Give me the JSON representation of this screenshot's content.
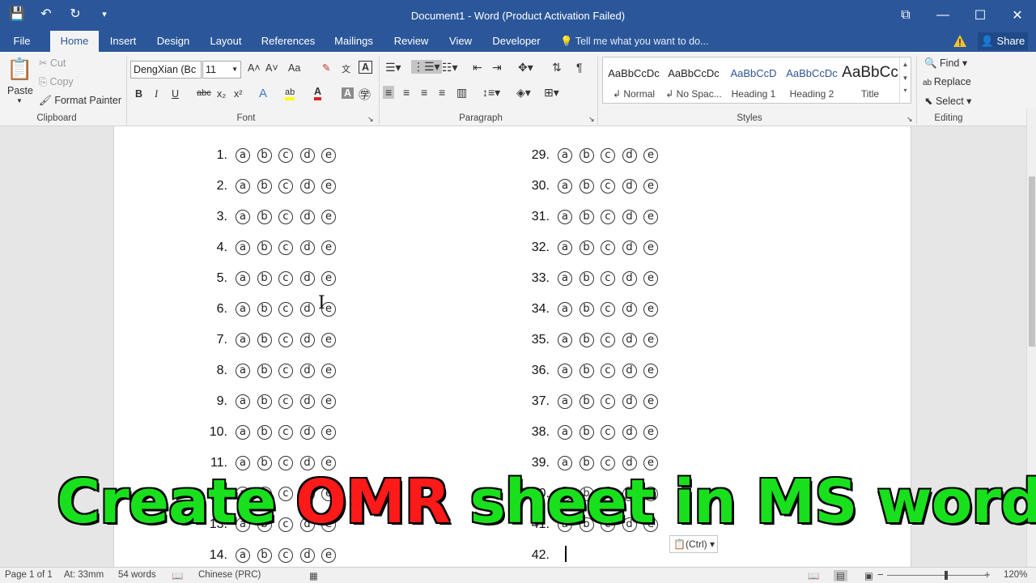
{
  "window": {
    "title": "Document1 - Word (Product Activation Failed)",
    "minimize": "—",
    "maximize": "☐",
    "close": "✕",
    "ribbon_display": "⧉"
  },
  "qat": {
    "save_icon": "💾",
    "undo_icon": "↶",
    "redo_icon": "↻",
    "customize_icon": "▾"
  },
  "tabs": [
    {
      "label": "File"
    },
    {
      "label": "Home"
    },
    {
      "label": "Insert"
    },
    {
      "label": "Design"
    },
    {
      "label": "Layout"
    },
    {
      "label": "References"
    },
    {
      "label": "Mailings"
    },
    {
      "label": "Review"
    },
    {
      "label": "View"
    },
    {
      "label": "Developer"
    }
  ],
  "tellme": "Tell me what you want to do...",
  "share": "Share",
  "clipboard": {
    "paste": "Paste",
    "cut": "Cut",
    "copy": "Copy",
    "format_painter": "Format Painter",
    "group": "Clipboard"
  },
  "font": {
    "name": "DengXian (Bc",
    "size": "11",
    "group": "Font",
    "bold": "B",
    "italic": "I",
    "underline": "U",
    "strike": "abc",
    "sub": "x₂",
    "sup": "x²",
    "grow": "A˄",
    "shrink": "A˅",
    "case": "Aa",
    "texteffects": "A",
    "highlight": "ab",
    "color": "A",
    "shade": "A"
  },
  "paragraph": {
    "group": "Paragraph"
  },
  "styles": {
    "group": "Styles",
    "items": [
      {
        "preview": "AaBbCcDc",
        "name": "↲ Normal"
      },
      {
        "preview": "AaBbCcDc",
        "name": "↲ No Spac..."
      },
      {
        "preview": "AaBbCcD",
        "name": "Heading 1"
      },
      {
        "preview": "AaBbCcDc",
        "name": "Heading 2"
      },
      {
        "preview": "AaBbCc",
        "name": "Title"
      }
    ]
  },
  "editing": {
    "group": "Editing",
    "find": "Find",
    "replace": "Replace",
    "select": "Select"
  },
  "document": {
    "left_questions": [
      "1.",
      "2.",
      "3.",
      "4.",
      "5.",
      "6.",
      "7.",
      "8.",
      "9.",
      "10.",
      "11.",
      "12.",
      "13.",
      "14."
    ],
    "right_questions": [
      "29.",
      "30.",
      "31.",
      "32.",
      "33.",
      "34.",
      "35.",
      "36.",
      "37.",
      "38.",
      "39.",
      "40.",
      "41.",
      "42."
    ],
    "options": [
      "a",
      "b",
      "c",
      "d",
      "e"
    ],
    "paste_options": "(Ctrl)"
  },
  "overlay": {
    "part1": "Create ",
    "part2": "OMR",
    "part3": " sheet in MS word"
  },
  "status": {
    "page": "Page 1 of 1",
    "at": "At: 33mm",
    "words": "54 words",
    "language": "Chinese (PRC)",
    "zoom": "120%",
    "zoom_level": 0.6
  },
  "colors": {
    "word_blue": "#2b579a",
    "overlay_green": "#19e01d",
    "overlay_red": "#ff1a1a"
  }
}
